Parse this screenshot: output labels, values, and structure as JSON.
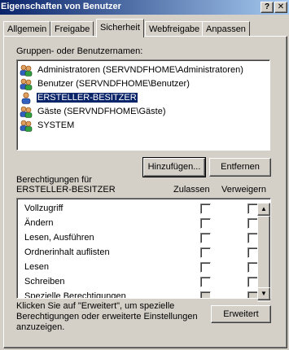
{
  "window": {
    "title": "Eigenschaften von Benutzer",
    "help_glyph": "?",
    "close_glyph": "✕"
  },
  "tabs": [
    {
      "label": "Allgemein",
      "active": false
    },
    {
      "label": "Freigabe",
      "active": false
    },
    {
      "label": "Sicherheit",
      "active": true
    },
    {
      "label": "Webfreigabe",
      "active": false
    },
    {
      "label": "Anpassen",
      "active": false
    }
  ],
  "groups_label": "Gruppen- oder Benutzernamen:",
  "groups": [
    {
      "name": "Administratoren (SERVNDFHOME\\Administratoren)",
      "icon": "users-icon",
      "selected": false
    },
    {
      "name": "Benutzer (SERVNDFHOME\\Benutzer)",
      "icon": "users-icon",
      "selected": false
    },
    {
      "name": "ERSTELLER-BESITZER",
      "icon": "user-icon",
      "selected": true
    },
    {
      "name": "Gäste (SERVNDFHOME\\Gäste)",
      "icon": "users-icon",
      "selected": false
    },
    {
      "name": "SYSTEM",
      "icon": "users-icon",
      "selected": false
    }
  ],
  "buttons": {
    "add": "Hinzufügen...",
    "remove": "Entfernen",
    "advanced": "Erweitert"
  },
  "permissions": {
    "label_line1": "Berechtigungen für",
    "label_line2": "ERSTELLER-BESITZER",
    "allow_header": "Zulassen",
    "deny_header": "Verweigern",
    "items": [
      {
        "name": "Vollzugriff",
        "allow": false,
        "deny": false
      },
      {
        "name": "Ändern",
        "allow": false,
        "deny": false
      },
      {
        "name": "Lesen, Ausführen",
        "allow": false,
        "deny": false
      },
      {
        "name": "Ordnerinhalt auflisten",
        "allow": false,
        "deny": false
      },
      {
        "name": "Lesen",
        "allow": false,
        "deny": false
      },
      {
        "name": "Schreiben",
        "allow": false,
        "deny": false
      },
      {
        "name": "Spezielle Berechtigungen",
        "allow": false,
        "deny": false,
        "disabled": true
      }
    ]
  },
  "footer_text": {
    "line1": "Klicken Sie auf \"Erweitert\", um spezielle",
    "line2": "Berechtigungen oder erweiterte Einstellungen",
    "line3": "anzuzeigen."
  },
  "colors": {
    "face": "#d4d0c8",
    "title_active": "#0a246a",
    "selection": "#0a246a"
  }
}
